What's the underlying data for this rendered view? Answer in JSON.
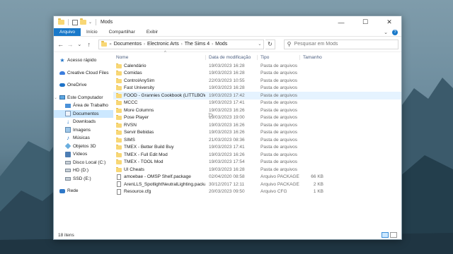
{
  "window": {
    "title": "Mods",
    "controls": {
      "minimize": "—",
      "maximize": "☐",
      "close": "✕"
    }
  },
  "ribbon": {
    "tabs": [
      "Arquivo",
      "Início",
      "Compartilhar",
      "Exibir"
    ],
    "expand": "⌄",
    "help": "?"
  },
  "nav": {
    "back": "←",
    "forward": "→",
    "recent": "⌄",
    "up": "↑",
    "breadcrumbs": [
      "Documentos",
      "Electronic Arts",
      "The Sims 4",
      "Mods"
    ],
    "overflow": "«",
    "refresh": "↻",
    "search_placeholder": "Pesquisar em Mods"
  },
  "sidebar": {
    "items": [
      {
        "label": "Acesso rápido",
        "icon": "star-icon"
      },
      {
        "label": "Creative Cloud Files",
        "icon": "cloud-icon"
      },
      {
        "label": "OneDrive",
        "icon": "onedrive-icon"
      },
      {
        "label": "Este Computador",
        "icon": "pc-icon"
      },
      {
        "label": "Área de Trabalho",
        "icon": "desktop-icon"
      },
      {
        "label": "Documentos",
        "icon": "documents-icon"
      },
      {
        "label": "Downloads",
        "icon": "download-icon"
      },
      {
        "label": "Imagens",
        "icon": "pictures-icon"
      },
      {
        "label": "Músicas",
        "icon": "music-icon"
      },
      {
        "label": "Objetos 3D",
        "icon": "objects3d-icon"
      },
      {
        "label": "Vídeos",
        "icon": "videos-icon"
      },
      {
        "label": "Disco Local (C:)",
        "icon": "drive-icon"
      },
      {
        "label": "HD (D:)",
        "icon": "drive-icon"
      },
      {
        "label": "SSD (E:)",
        "icon": "drive-icon"
      },
      {
        "label": "Rede",
        "icon": "network-icon"
      }
    ]
  },
  "columns": {
    "name": "Nome",
    "date": "Data de modificação",
    "type": "Tipo",
    "size": "Tamanho"
  },
  "files": [
    {
      "name": "Calendário",
      "date": "19/03/2023 16:28",
      "type": "Pasta de arquivos",
      "size": ""
    },
    {
      "name": "Comidas",
      "date": "19/03/2023 16:28",
      "type": "Pasta de arquivos",
      "size": ""
    },
    {
      "name": "ControlAnySim",
      "date": "22/03/2023 10:55",
      "type": "Pasta de arquivos",
      "size": ""
    },
    {
      "name": "Fast University",
      "date": "19/03/2023 16:28",
      "type": "Pasta de arquivos",
      "size": ""
    },
    {
      "name": "FOOD - Grannies Cookbook (LITTLBOWB...",
      "date": "19/03/2023 17:42",
      "type": "Pasta de arquivos",
      "size": ""
    },
    {
      "name": "MCCC",
      "date": "19/03/2023 17:41",
      "type": "Pasta de arquivos",
      "size": ""
    },
    {
      "name": "More Columns",
      "date": "19/03/2023 16:26",
      "type": "Pasta de arquivos",
      "size": ""
    },
    {
      "name": "Pose Player",
      "date": "19/03/2023 19:00",
      "type": "Pasta de arquivos",
      "size": ""
    },
    {
      "name": "RVSN",
      "date": "19/03/2023 16:26",
      "type": "Pasta de arquivos",
      "size": ""
    },
    {
      "name": "Servir Bebidas",
      "date": "19/03/2023 16:26",
      "type": "Pasta de arquivos",
      "size": ""
    },
    {
      "name": "SIMS",
      "date": "21/03/2023 08:36",
      "type": "Pasta de arquivos",
      "size": ""
    },
    {
      "name": "TMEX - Better Build Buy",
      "date": "19/03/2023 17:41",
      "type": "Pasta de arquivos",
      "size": ""
    },
    {
      "name": "TMEX - Full Edit Mod",
      "date": "19/03/2023 16:26",
      "type": "Pasta de arquivos",
      "size": ""
    },
    {
      "name": "TMEX - TOOL Mod",
      "date": "19/03/2023 17:54",
      "type": "Pasta de arquivos",
      "size": ""
    },
    {
      "name": "UI Cheats",
      "date": "19/03/2023 16:28",
      "type": "Pasta de arquivos",
      "size": ""
    },
    {
      "name": "amoebae - OMSP Shelf.package",
      "date": "02/04/2020 08:58",
      "type": "Arquivo PACKAGE",
      "size": "66 KB"
    },
    {
      "name": "ArenLLS_SpotlightNeutralLighting.package",
      "date": "30/12/2017 12:11",
      "type": "Arquivo PACKAGE",
      "size": "2 KB"
    },
    {
      "name": "Resource.cfg",
      "date": "20/03/2023 09:50",
      "type": "Arquivo CFG",
      "size": "1 KB"
    }
  ],
  "status": {
    "count": "18 itens"
  }
}
